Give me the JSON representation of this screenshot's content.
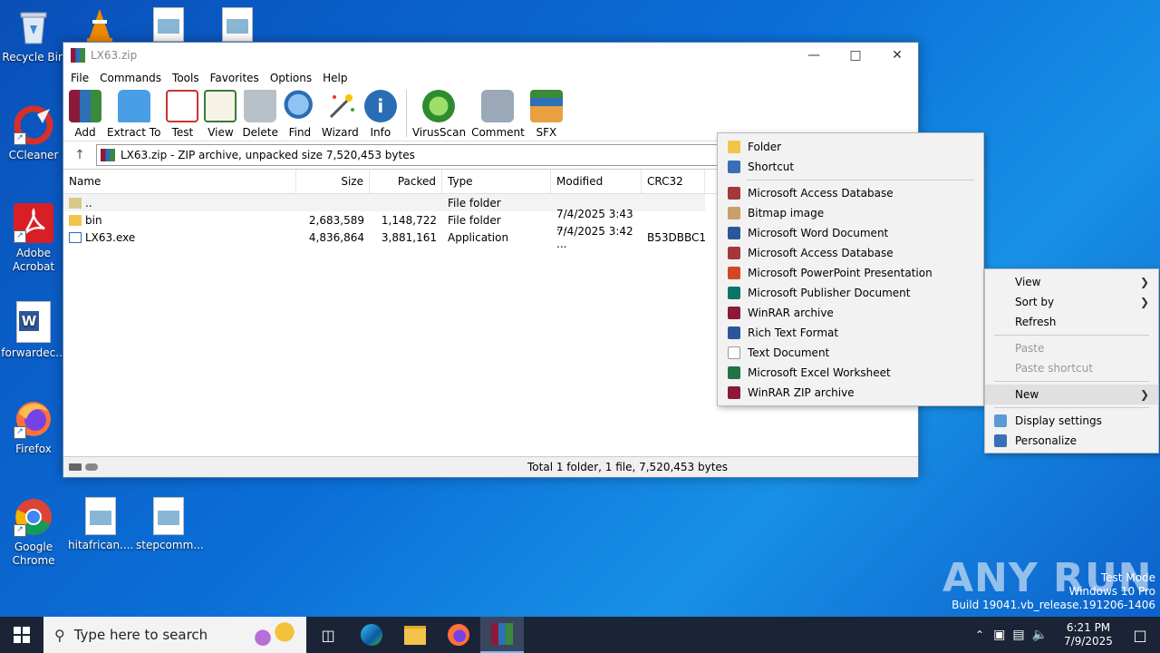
{
  "desktop": {
    "icons": [
      {
        "label": "Recycle Bin"
      },
      {
        "label": "CCleaner"
      },
      {
        "label": "Adobe Acrobat"
      },
      {
        "label": "forwardec..."
      },
      {
        "label": "Firefox"
      },
      {
        "label": "Google Chrome"
      },
      {
        "label": "hitafrican...."
      },
      {
        "label": "stepcomm..."
      }
    ]
  },
  "window": {
    "title": "LX63.zip",
    "menu": [
      "File",
      "Commands",
      "Tools",
      "Favorites",
      "Options",
      "Help"
    ],
    "toolbar": [
      "Add",
      "Extract To",
      "Test",
      "View",
      "Delete",
      "Find",
      "Wizard",
      "Info",
      "VirusScan",
      "Comment",
      "SFX"
    ],
    "address": "LX63.zip - ZIP archive, unpacked size 7,520,453 bytes",
    "columns": [
      "Name",
      "Size",
      "Packed",
      "Type",
      "Modified",
      "CRC32"
    ],
    "rows": [
      {
        "name": "..",
        "size": "",
        "packed": "",
        "type": "File folder",
        "modified": "",
        "crc": ""
      },
      {
        "name": "bin",
        "size": "2,683,589",
        "packed": "1,148,722",
        "type": "File folder",
        "modified": "7/4/2025 3:43 ...",
        "crc": ""
      },
      {
        "name": "LX63.exe",
        "size": "4,836,864",
        "packed": "3,881,161",
        "type": "Application",
        "modified": "7/4/2025 3:42 ...",
        "crc": "B53DBBC1"
      }
    ],
    "status": "Total 1 folder, 1 file, 7,520,453 bytes"
  },
  "new_menu": {
    "items": [
      {
        "label": "Folder",
        "color": "#f3c44a"
      },
      {
        "label": "Shortcut",
        "color": "#3a6fb5"
      },
      {
        "label": "Microsoft Access Database",
        "color": "#a4373a"
      },
      {
        "label": "Bitmap image",
        "color": "#c8a06a"
      },
      {
        "label": "Microsoft Word Document",
        "color": "#2b579a"
      },
      {
        "label": "Microsoft Access Database",
        "color": "#a4373a"
      },
      {
        "label": "Microsoft PowerPoint Presentation",
        "color": "#d24726"
      },
      {
        "label": "Microsoft Publisher Document",
        "color": "#077568"
      },
      {
        "label": "WinRAR archive",
        "color": "#8b1a3a"
      },
      {
        "label": "Rich Text Format",
        "color": "#2b579a"
      },
      {
        "label": "Text Document",
        "color": "#dddddd"
      },
      {
        "label": "Microsoft Excel Worksheet",
        "color": "#217346"
      },
      {
        "label": "WinRAR ZIP archive",
        "color": "#8b1a3a"
      }
    ]
  },
  "desktop_menu": {
    "view": "View",
    "sort_by": "Sort by",
    "refresh": "Refresh",
    "paste": "Paste",
    "paste_shortcut": "Paste shortcut",
    "new": "New",
    "display_settings": "Display settings",
    "personalize": "Personalize"
  },
  "taskbar": {
    "search_placeholder": "Type here to search",
    "time": "6:21 PM",
    "date": "7/9/2025"
  },
  "watermark": {
    "logo": "ANY RUN",
    "line1": "Test Mode",
    "line2": "Windows 10 Pro",
    "line3": "Build 19041.vb_release.191206-1406"
  }
}
